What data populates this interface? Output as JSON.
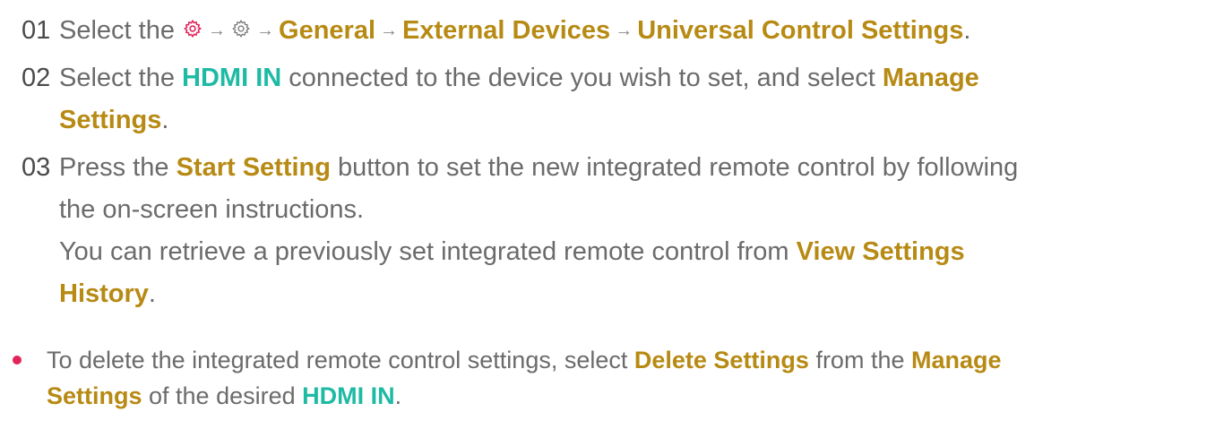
{
  "colors": {
    "text": "#6b6b6b",
    "number": "#4a4a4a",
    "highlight_gold": "#b78a14",
    "highlight_teal": "#1ebaa4",
    "bullet": "#e2245a",
    "settings_icon_red": "#e2245a"
  },
  "icons": {
    "settings_red": "gear-icon",
    "settings_grey": "gear-icon",
    "arrow": "arrow-right-icon"
  },
  "steps": [
    {
      "number": "01",
      "text_1": "Select the ",
      "arrow": "→",
      "item_1": "General",
      "item_2": "External Devices",
      "item_3": "Universal Control Settings",
      "end": "."
    },
    {
      "number": "02",
      "text_1": "Select the ",
      "hdmi": "HDMI IN",
      "text_2": " connected to the device you wish to set, and select ",
      "manage_line1": "Manage",
      "manage_line2": "Settings",
      "end": "."
    },
    {
      "number": "03",
      "text_1": "Press the ",
      "start_setting": "Start Setting",
      "text_2": " button to set the new integrated remote control by following",
      "text_3": "the on-screen instructions.",
      "text_4": "You can retrieve a previously set integrated remote control from ",
      "view_line1": "View Settings",
      "view_line2": "History",
      "end": "."
    }
  ],
  "note": {
    "text_1": "To delete the integrated remote control settings, select ",
    "delete_settings": "Delete Settings",
    "text_2": " from the ",
    "manage_line1": "Manage",
    "manage_line2": "Settings",
    "text_3": " of the desired ",
    "hdmi": "HDMI IN",
    "end": "."
  }
}
